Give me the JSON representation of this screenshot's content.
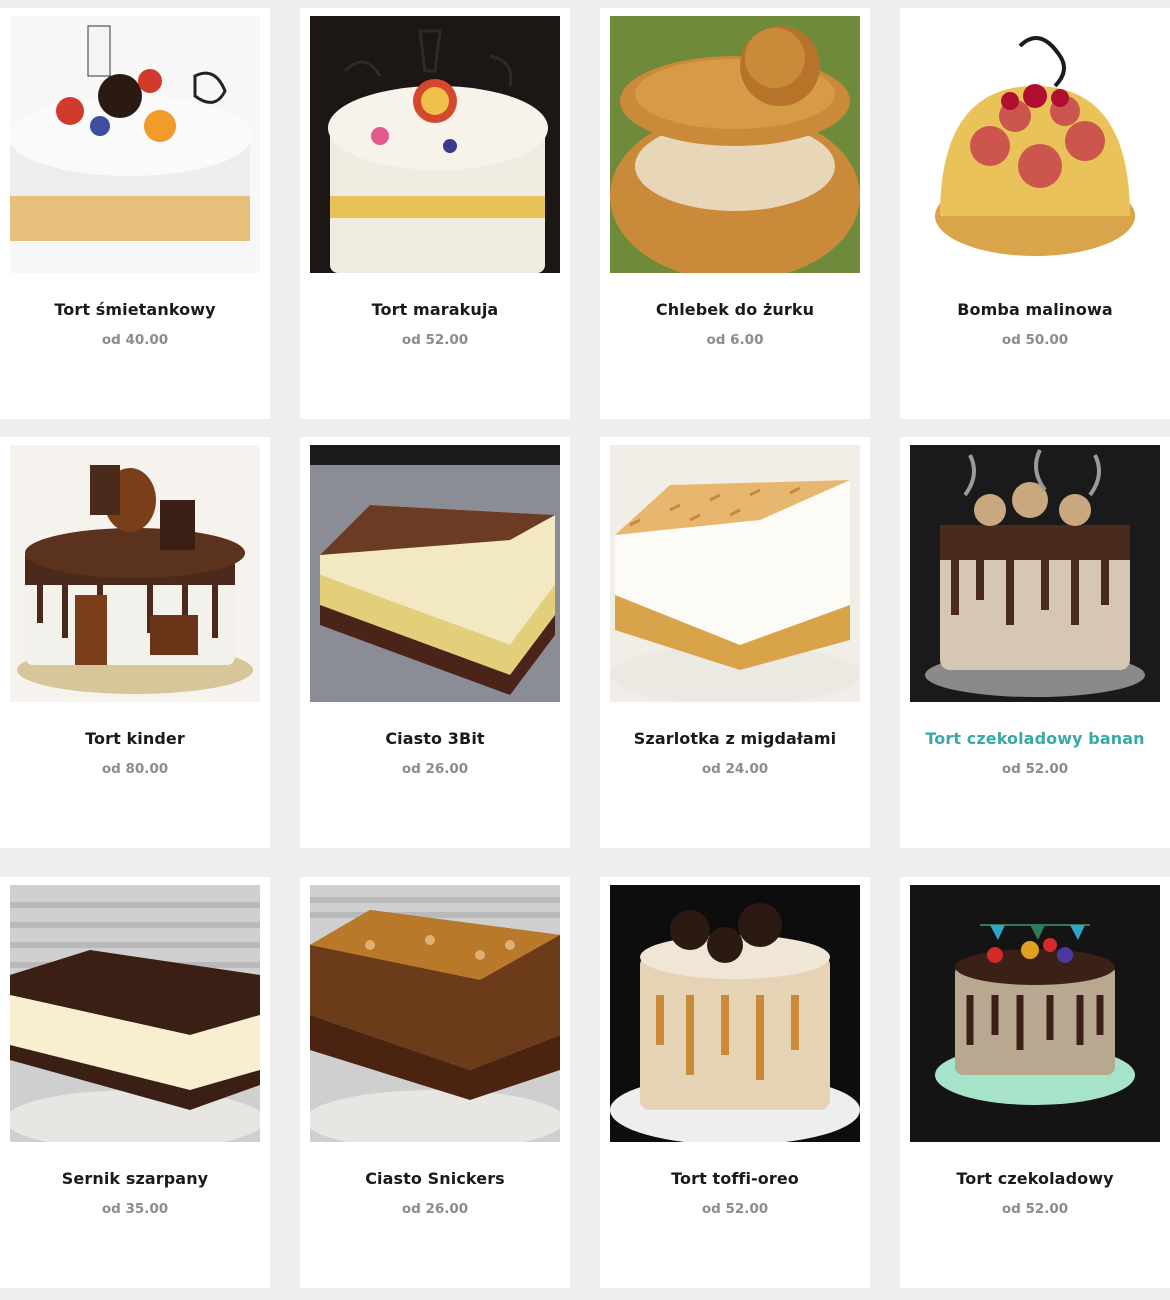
{
  "products": [
    {
      "name": "Tort śmietankowy",
      "price": "od 40.00",
      "image": "cream-fruit-cake",
      "colors": [
        "#eeeeee",
        "#f4f4f0",
        "#e9c27a",
        "#d23a2e",
        "#3d4fa0"
      ]
    },
    {
      "name": "Tort marakuja",
      "price": "od 52.00",
      "image": "passionfruit-cake",
      "colors": [
        "#1c1614",
        "#f3efe7",
        "#e8c35a",
        "#2b2b2b",
        "#d4482f"
      ]
    },
    {
      "name": "Chlebek do żurku",
      "price": "od 6.00",
      "image": "bread-bowl",
      "colors": [
        "#6f8a3a",
        "#c98a3a",
        "#e7d6b8",
        "#b8732a",
        "#9a6b2a"
      ]
    },
    {
      "name": "Bomba malinowa",
      "price": "od 50.00",
      "image": "raspberry-bomb",
      "colors": [
        "#ffffff",
        "#e9c35a",
        "#c23049",
        "#d9a44a",
        "#1c1c1c"
      ]
    },
    {
      "name": "Tort kinder",
      "price": "od 80.00",
      "image": "kinder-cake",
      "colors": [
        "#f6f2ee",
        "#4a2a1a",
        "#f3f1ec",
        "#7a3e1a",
        "#d7c69a"
      ]
    },
    {
      "name": "Ciasto 3Bit",
      "price": "od 26.00",
      "image": "3bit-slice",
      "colors": [
        "#8a8d95",
        "#6b3b24",
        "#f2e8c2",
        "#e3cf7a",
        "#4a2418"
      ]
    },
    {
      "name": "Szarlotka z migdałami",
      "price": "od 24.00",
      "image": "apple-pie-almonds",
      "colors": [
        "#f1eee8",
        "#e7b770",
        "#fdfbf6",
        "#d9a34a",
        "#ece9e3"
      ]
    },
    {
      "name": "Tort czekoladowy banan",
      "price": "od 52.00",
      "image": "chocolate-banana-cake",
      "colors": [
        "#1a1a1a",
        "#4a2a1a",
        "#c9a880",
        "#d6c7b4",
        "#8a8a8a"
      ]
    },
    {
      "name": "Sernik szarpany",
      "price": "od 35.00",
      "image": "cheesecake-slice",
      "colors": [
        "#cfcfcf",
        "#3b1f14",
        "#f7efcf",
        "#e8e6e3",
        "#a9a9a9"
      ]
    },
    {
      "name": "Ciasto Snickers",
      "price": "od 26.00",
      "image": "snickers-slice",
      "colors": [
        "#cfcfcf",
        "#4a2410",
        "#b87a2a",
        "#e8e6e3",
        "#6b3b1a"
      ]
    },
    {
      "name": "Tort toffi-oreo",
      "price": "od 52.00",
      "image": "toffee-oreo-cake",
      "colors": [
        "#0d0d0d",
        "#e6d3b6",
        "#2a1a12",
        "#c98a3a",
        "#eeeeee"
      ]
    },
    {
      "name": "Tort czekoladowy",
      "price": "od 52.00",
      "image": "chocolate-cake",
      "colors": [
        "#141414",
        "#b9a890",
        "#3a2016",
        "#a7e3c9",
        "#d42a2a"
      ]
    }
  ],
  "hovered_product_index": 7
}
